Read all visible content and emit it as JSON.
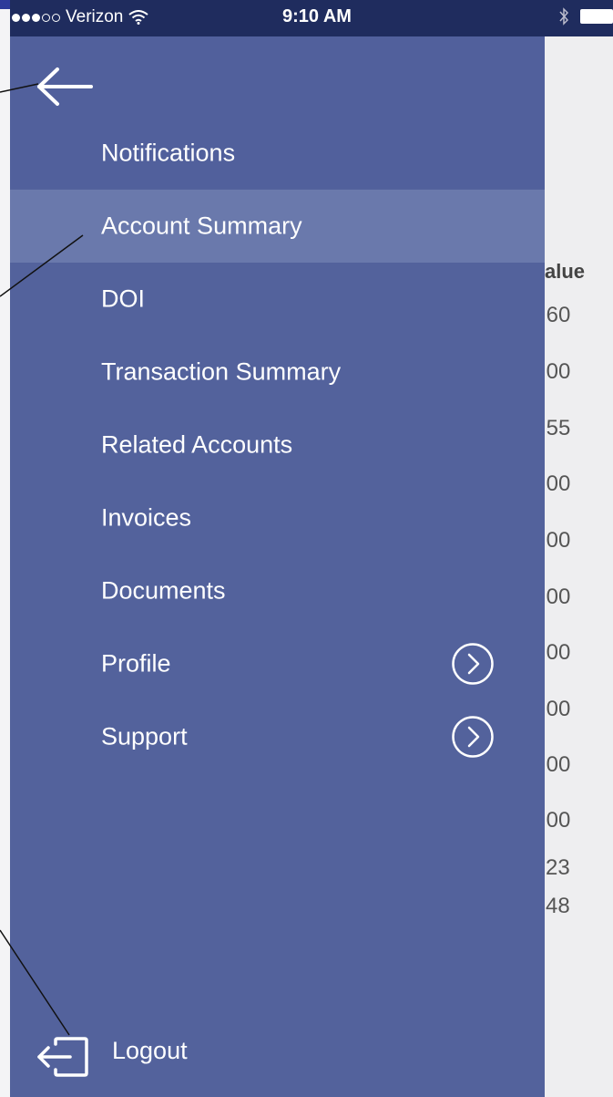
{
  "status_bar": {
    "carrier": "Verizon",
    "time": "9:10 AM",
    "signal_bars_filled": 3,
    "signal_bars_total": 5,
    "icons": [
      "wifi-icon",
      "bluetooth-icon",
      "battery-icon"
    ]
  },
  "drawer": {
    "back_icon": "arrow-left-icon",
    "items": [
      {
        "label": "Notifications",
        "active": false,
        "chevron": false
      },
      {
        "label": "Account Summary",
        "active": true,
        "chevron": false
      },
      {
        "label": "DOI",
        "active": false,
        "chevron": false
      },
      {
        "label": "Transaction Summary",
        "active": false,
        "chevron": false
      },
      {
        "label": "Related Accounts",
        "active": false,
        "chevron": false
      },
      {
        "label": "Invoices",
        "active": false,
        "chevron": false
      },
      {
        "label": "Documents",
        "active": false,
        "chevron": false
      },
      {
        "label": "Profile",
        "active": false,
        "chevron": true
      },
      {
        "label": "Support",
        "active": false,
        "chevron": true
      }
    ],
    "logout_label": "Logout",
    "logout_icon": "logout-icon"
  },
  "background": {
    "column_header": "alue",
    "values": [
      ".60",
      ".00",
      ".55",
      ".00",
      ".00",
      ".00",
      ".00",
      ".00",
      ".00",
      ".00",
      "23",
      "48"
    ]
  },
  "colors": {
    "status_bar": "#1f2c5e",
    "drawer": "#53629c",
    "active_item": "#6a79ac",
    "text": "#ffffff"
  }
}
